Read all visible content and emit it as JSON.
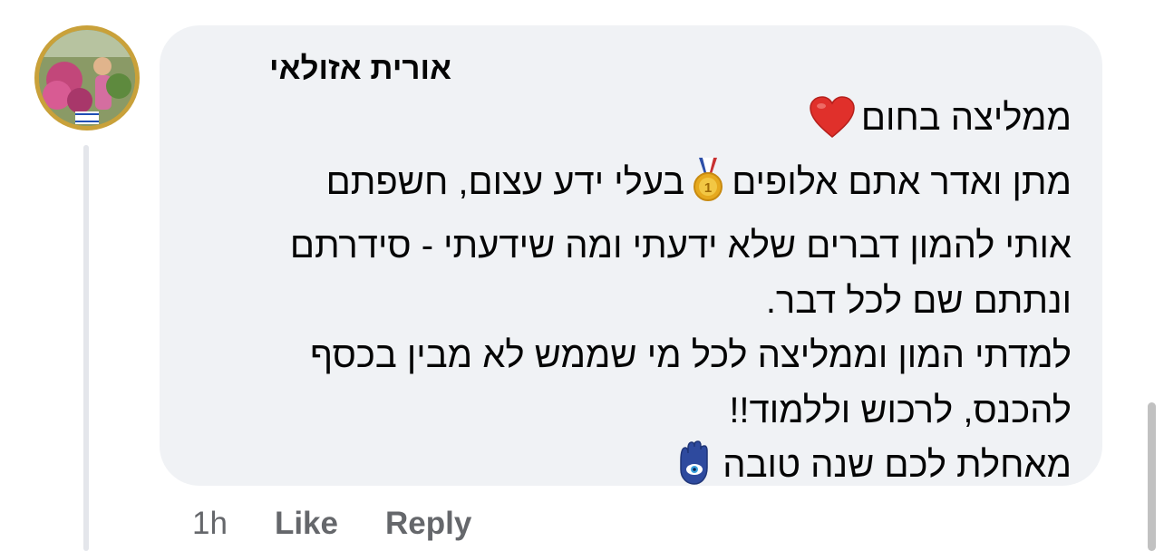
{
  "comment": {
    "author": "אורית אזולאי",
    "avatar_icon": "profile-photo",
    "lines": [
      {
        "text": "ממליצה בחום",
        "emoji_after": "heart-emoji"
      },
      {
        "text_before": "מתן ואדר אתם אלופים",
        "emoji": "medal-emoji",
        "text_after": "בעלי ידע עצום, חשפתם"
      },
      {
        "text": "אותי להמון דברים שלא ידעתי ומה שידעתי - סידרתם"
      },
      {
        "text": "ונתתם שם לכל דבר."
      },
      {
        "text": "למדתי המון וממליצה לכל מי שממש לא מבין בכסף"
      },
      {
        "text": "להכנס, לרכוש וללמוד!!"
      },
      {
        "text": "מאחלת לכם שנה טובה",
        "emoji_after": "hamsa-emoji"
      }
    ],
    "timestamp": "1h",
    "like_label": "Like",
    "reply_label": "Reply"
  },
  "colors": {
    "bubble_bg": "#f0f2f5",
    "text": "#050505",
    "secondary_text": "#65676b"
  }
}
